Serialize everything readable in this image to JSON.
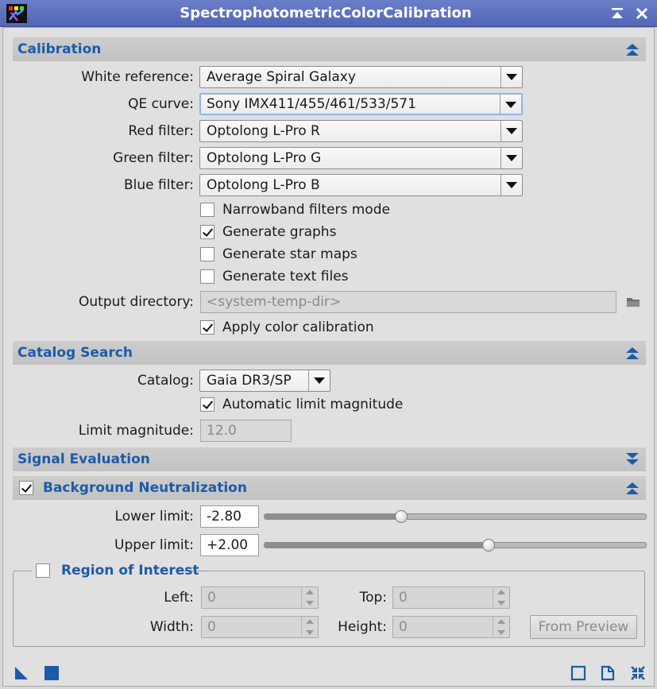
{
  "window": {
    "title": "SpectrophotometricColorCalibration",
    "app_icon": "pixinsight-icon",
    "shade_icon": "shade-icon",
    "close_icon": "close-icon"
  },
  "calibration": {
    "title": "Calibration",
    "white_reference": {
      "label": "White reference:",
      "value": "Average Spiral Galaxy"
    },
    "qe_curve": {
      "label": "QE curve:",
      "value": "Sony IMX411/455/461/533/571"
    },
    "red_filter": {
      "label": "Red filter:",
      "value": "Optolong L-Pro R"
    },
    "green_filter": {
      "label": "Green filter:",
      "value": "Optolong L-Pro G"
    },
    "blue_filter": {
      "label": "Blue filter:",
      "value": "Optolong L-Pro B"
    },
    "narrowband": {
      "label": "Narrowband filters mode",
      "checked": false
    },
    "generate_graphs": {
      "label": "Generate graphs",
      "checked": true
    },
    "generate_star_maps": {
      "label": "Generate star maps",
      "checked": false
    },
    "generate_text_files": {
      "label": "Generate text files",
      "checked": false
    },
    "output_directory": {
      "label": "Output directory:",
      "placeholder": "<system-temp-dir>"
    },
    "apply_color_calibration": {
      "label": "Apply color calibration",
      "checked": true
    }
  },
  "catalog_search": {
    "title": "Catalog Search",
    "catalog": {
      "label": "Catalog:",
      "value": "Gaia DR3/SP"
    },
    "automatic_limit": {
      "label": "Automatic limit magnitude",
      "checked": true
    },
    "limit_magnitude": {
      "label": "Limit magnitude:",
      "value": "12.0"
    }
  },
  "signal_evaluation": {
    "title": "Signal Evaluation"
  },
  "background_neutralization": {
    "title": "Background Neutralization",
    "enabled": true,
    "lower_limit": {
      "label": "Lower limit:",
      "value": "-2.80",
      "slider_fraction": 0.36
    },
    "upper_limit": {
      "label": "Upper limit:",
      "value": "+2.00",
      "slider_fraction": 0.59
    }
  },
  "region_of_interest": {
    "title": "Region of Interest",
    "enabled": false,
    "left": {
      "label": "Left:",
      "value": "0"
    },
    "top": {
      "label": "Top:",
      "value": "0"
    },
    "width": {
      "label": "Width:",
      "value": "0"
    },
    "height": {
      "label": "Height:",
      "value": "0"
    },
    "from_preview": "From Preview"
  },
  "colors": {
    "accent": "#1c5ba8",
    "titlebar": "#5b6fbf"
  }
}
